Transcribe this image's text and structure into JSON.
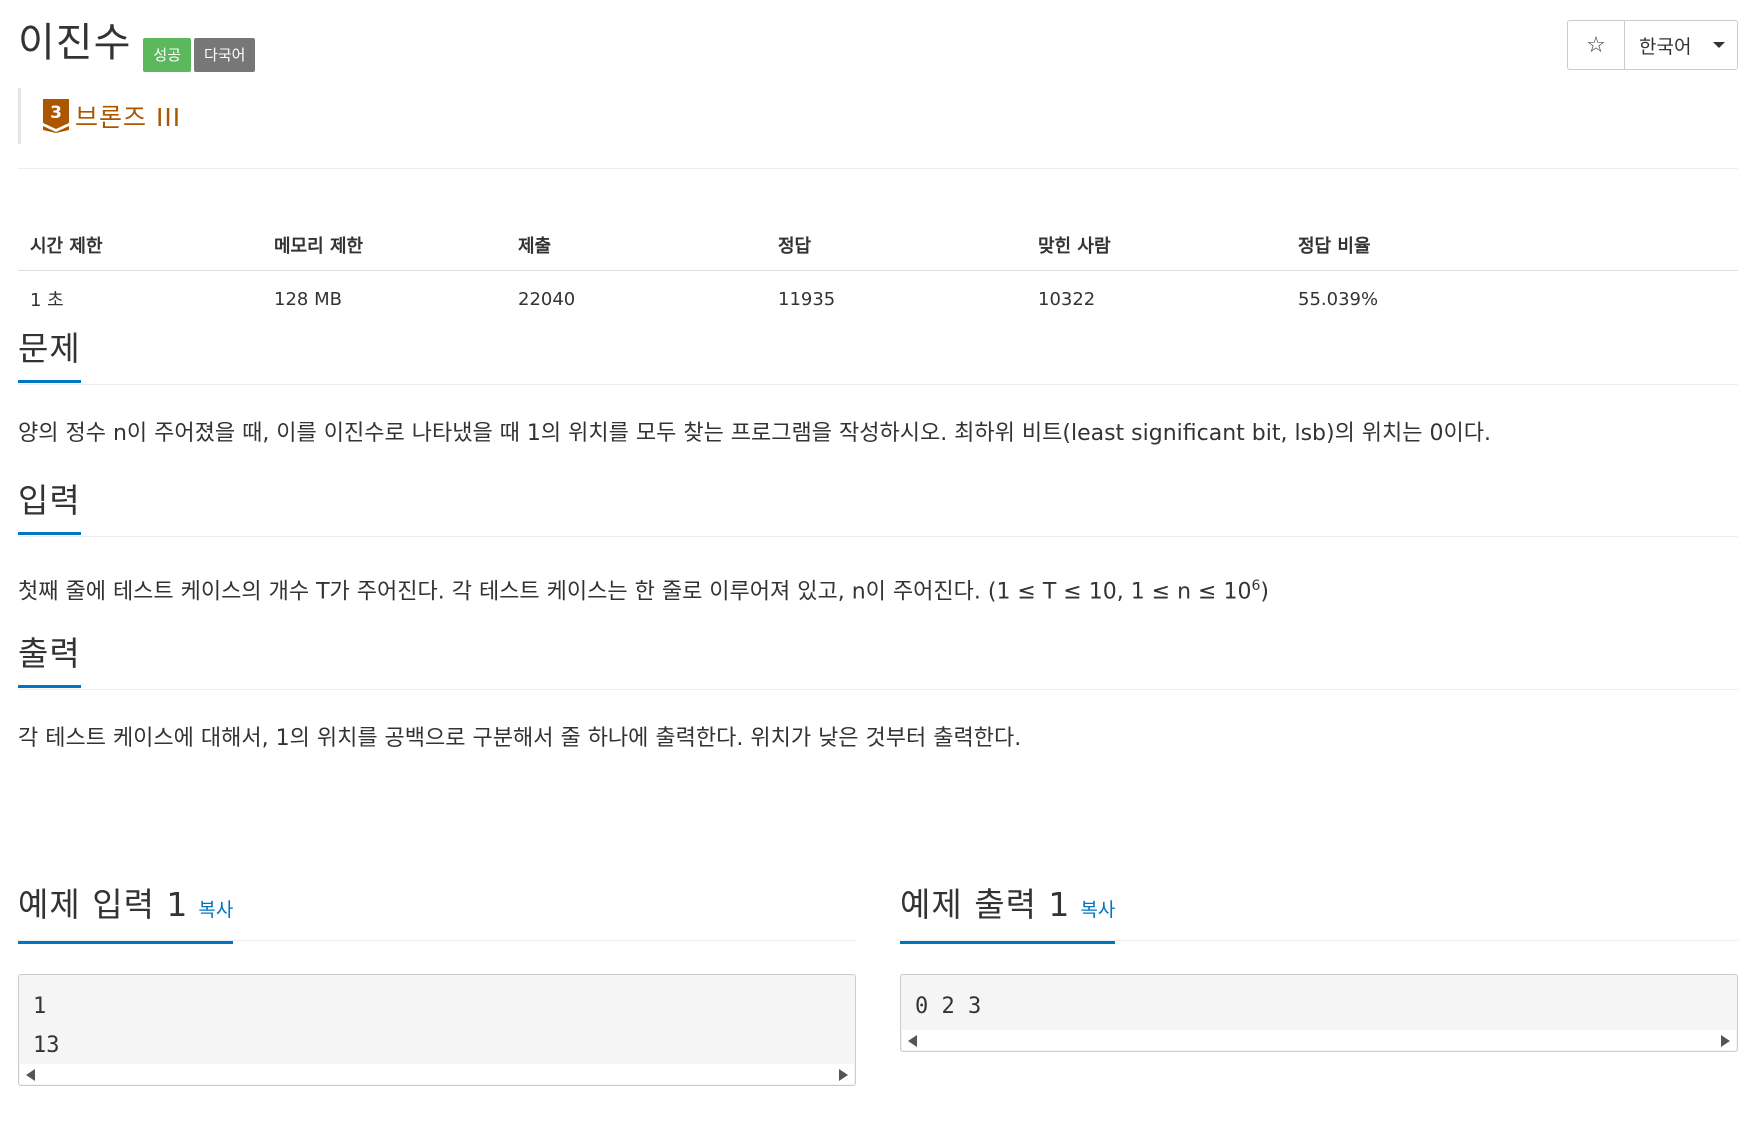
{
  "header": {
    "title": "이진수",
    "labels": {
      "success": "성공",
      "multilang": "다국어"
    },
    "tier": {
      "number": "3",
      "name": "브론즈 III"
    },
    "star": "☆",
    "language": "한국어"
  },
  "info": {
    "headers": [
      "시간 제한",
      "메모리 제한",
      "제출",
      "정답",
      "맞힌 사람",
      "정답 비율"
    ],
    "values": [
      "1 초",
      "128 MB",
      "22040",
      "11935",
      "10322",
      "55.039%"
    ]
  },
  "sections": {
    "problem": {
      "title": "문제",
      "text": "양의 정수 n이 주어졌을 때, 이를 이진수로 나타냈을 때 1의 위치를 모두 찾는 프로그램을 작성하시오. 최하위 비트(least significant bit, lsb)의 위치는 0이다."
    },
    "input": {
      "title": "입력",
      "text": "첫째 줄에 테스트 케이스의 개수 T가 주어진다. 각 테스트 케이스는 한 줄로 이루어져 있고, n이 주어진다. (1 ≤ T ≤ 10, 1 ≤ n ≤ 10",
      "sup": "6",
      "text_end": ")"
    },
    "output": {
      "title": "출력",
      "text": "각 테스트 케이스에 대해서, 1의 위치를 공백으로 구분해서 줄 하나에 출력한다. 위치가 낮은 것부터 출력한다."
    }
  },
  "samples": {
    "input": {
      "title": "예제 입력 1",
      "copy": "복사",
      "content": "1\n13"
    },
    "output": {
      "title": "예제 출력 1",
      "copy": "복사",
      "content": "0 2 3"
    }
  }
}
